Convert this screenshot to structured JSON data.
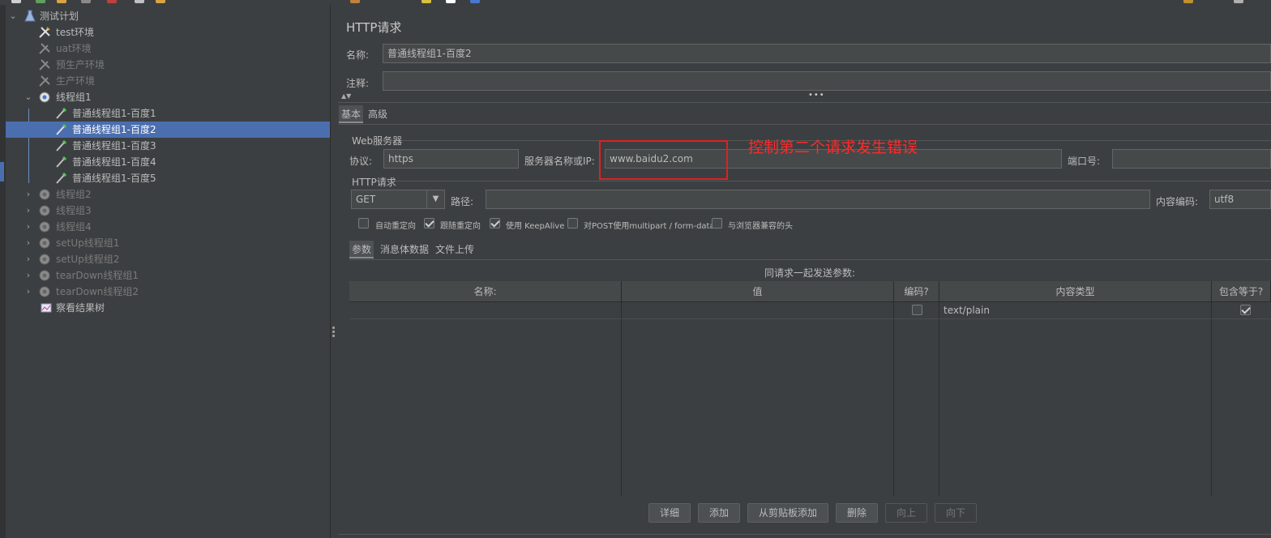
{
  "tree": {
    "items": [
      {
        "label": "测试计划",
        "state": "enabled",
        "icon": "test-plan-icon"
      },
      {
        "label": "test环境",
        "state": "enabled",
        "icon": "config-element-icon"
      },
      {
        "label": "uat环境",
        "state": "disabled",
        "icon": "config-element-icon"
      },
      {
        "label": "预生产环境",
        "state": "disabled",
        "icon": "config-element-icon"
      },
      {
        "label": "生产环境",
        "state": "disabled",
        "icon": "config-element-icon"
      },
      {
        "label": "线程组1",
        "state": "enabled",
        "icon": "thread-group-icon"
      },
      {
        "label": "普通线程组1-百度1",
        "state": "enabled",
        "icon": "sampler-icon"
      },
      {
        "label": "普通线程组1-百度2",
        "state": "selected",
        "icon": "sampler-icon"
      },
      {
        "label": "普通线程组1-百度3",
        "state": "enabled",
        "icon": "sampler-icon"
      },
      {
        "label": "普通线程组1-百度4",
        "state": "enabled",
        "icon": "sampler-icon"
      },
      {
        "label": "普通线程组1-百度5",
        "state": "enabled",
        "icon": "sampler-icon"
      },
      {
        "label": "线程组2",
        "state": "disabled",
        "icon": "thread-group-icon"
      },
      {
        "label": "线程组3",
        "state": "disabled",
        "icon": "thread-group-icon"
      },
      {
        "label": "线程组4",
        "state": "disabled",
        "icon": "thread-group-icon"
      },
      {
        "label": "setUp线程组1",
        "state": "disabled",
        "icon": "thread-group-icon"
      },
      {
        "label": "setUp线程组2",
        "state": "disabled",
        "icon": "thread-group-icon"
      },
      {
        "label": "tearDown线程组1",
        "state": "disabled",
        "icon": "thread-group-icon"
      },
      {
        "label": "tearDown线程组2",
        "state": "disabled",
        "icon": "thread-group-icon"
      },
      {
        "label": "察看结果树",
        "state": "enabled",
        "icon": "listener-icon"
      }
    ]
  },
  "panel": {
    "title": "HTTP请求",
    "name_label": "名称:",
    "name_value": "普通线程组1-百度2",
    "comment_label": "注释:",
    "comment_value": "",
    "top_tabs": [
      "基本",
      "高级"
    ],
    "web_server": {
      "section_label": "Web服务器",
      "protocol_label": "协议:",
      "protocol_value": "https",
      "server_label": "服务器名称或IP:",
      "server_value": "www.baidu2.com",
      "port_label": "端口号:",
      "port_value": ""
    },
    "http_request": {
      "section_label": "HTTP请求",
      "method_value": "GET",
      "path_label": "路径:",
      "path_value": "",
      "encoding_label": "内容编码:",
      "encoding_value": "utf8"
    },
    "options": [
      {
        "label": "自动重定向",
        "checked": false
      },
      {
        "label": "跟随重定向",
        "checked": true
      },
      {
        "label": "使用 KeepAlive",
        "checked": true
      },
      {
        "label": "对POST使用multipart / form-data",
        "checked": false
      },
      {
        "label": "与浏览器兼容的头",
        "checked": false
      }
    ],
    "sub_tabs": [
      "参数",
      "消息体数据",
      "文件上传"
    ],
    "params": {
      "caption": "同请求一起发送参数:",
      "headers": [
        "名称:",
        "值",
        "编码?",
        "内容类型",
        "包含等于?"
      ],
      "rows": [
        {
          "name": "",
          "value": "",
          "encode": false,
          "content_type": "text/plain",
          "include_equals": true
        }
      ]
    },
    "buttons": [
      {
        "label": "详细",
        "enabled": true
      },
      {
        "label": "添加",
        "enabled": true
      },
      {
        "label": "从剪贴板添加",
        "enabled": true
      },
      {
        "label": "删除",
        "enabled": true
      },
      {
        "label": "向上",
        "enabled": false
      },
      {
        "label": "向下",
        "enabled": false
      }
    ]
  },
  "annotation": {
    "text": "控制第二个请求发生错误",
    "color": "#ff2a2a"
  },
  "colors": {
    "background": "#3c3f41",
    "selection": "#4b6eaf",
    "annotation": "#e02020"
  }
}
